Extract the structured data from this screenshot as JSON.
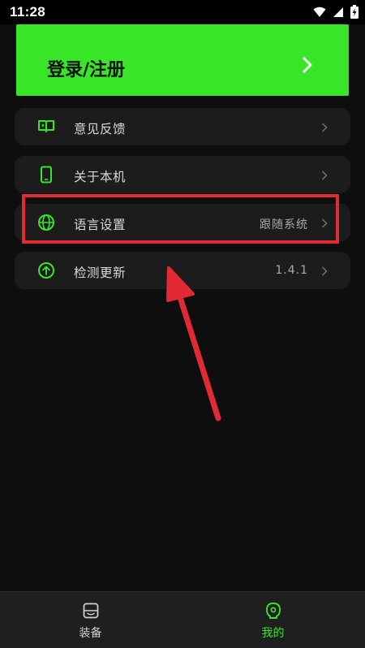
{
  "status_bar": {
    "time": "11:28",
    "icons": [
      "wifi-icon",
      "signal-icon",
      "battery-charging-icon"
    ]
  },
  "login": {
    "label": "登录/注册",
    "chevron_icon": "chevron-right-icon"
  },
  "menu": {
    "items": [
      {
        "icon": "feedback-book-icon",
        "label": "意见反馈",
        "value": ""
      },
      {
        "icon": "phone-icon",
        "label": "关于本机",
        "value": ""
      },
      {
        "icon": "globe-icon",
        "label": "语言设置",
        "value": "跟随系统"
      },
      {
        "icon": "update-arrow-icon",
        "label": "检测更新",
        "value": "1.4.1"
      }
    ]
  },
  "annotation": {
    "highlight_color": "#e12a34",
    "highlighted_item": "语言设置"
  },
  "bottom_nav": {
    "tabs": [
      {
        "icon": "equipment-icon",
        "label": "装备",
        "active": false
      },
      {
        "icon": "profile-icon",
        "label": "我的",
        "active": true
      }
    ]
  },
  "colors": {
    "accent": "#39e527",
    "background": "#0e0e0e",
    "card": "#1c1c1c",
    "annotation_red": "#e12a34"
  }
}
